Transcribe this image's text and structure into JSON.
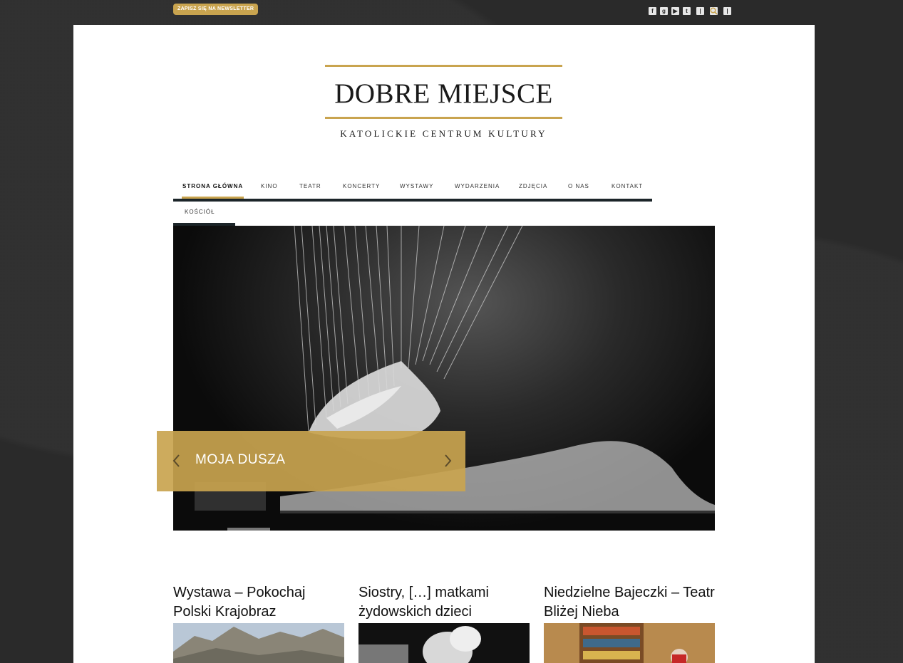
{
  "topbar": {
    "newsletter_label": "ZAPISZ SIĘ NA NEWSLETTER",
    "social_icons": [
      "facebook-icon",
      "google-plus-icon",
      "youtube-icon",
      "tumblr-icon"
    ],
    "search_icon": "search-icon"
  },
  "logo": {
    "title": "DOBRE MIEJSCE",
    "subtitle": "KATOLICKIE CENTRUM KULTURY"
  },
  "nav": {
    "items": [
      {
        "label": "STRONA GŁÓWNA",
        "active": true
      },
      {
        "label": "KINO"
      },
      {
        "label": "TEATR"
      },
      {
        "label": "KONCERTY"
      },
      {
        "label": "WYSTAWY"
      },
      {
        "label": "WYDARZENIA"
      },
      {
        "label": "ZDJĘCIA"
      },
      {
        "label": "O NAS"
      },
      {
        "label": "KONTAKT"
      }
    ],
    "second_row": [
      {
        "label": "KOŚCIÓŁ"
      }
    ]
  },
  "slider": {
    "caption": "MOJA DUSZA"
  },
  "posts": [
    {
      "title": "Wystawa – Pokochaj Polski Krajobraz"
    },
    {
      "title": "Siostry, […] matkami żydowskich dzieci"
    },
    {
      "title": "Niedzielne Bajeczki – Teatr Bliżej Nieba"
    }
  ],
  "colors": {
    "accent": "#c9a44f",
    "background": "#2a2a2a",
    "nav_bar": "#1c2529"
  }
}
